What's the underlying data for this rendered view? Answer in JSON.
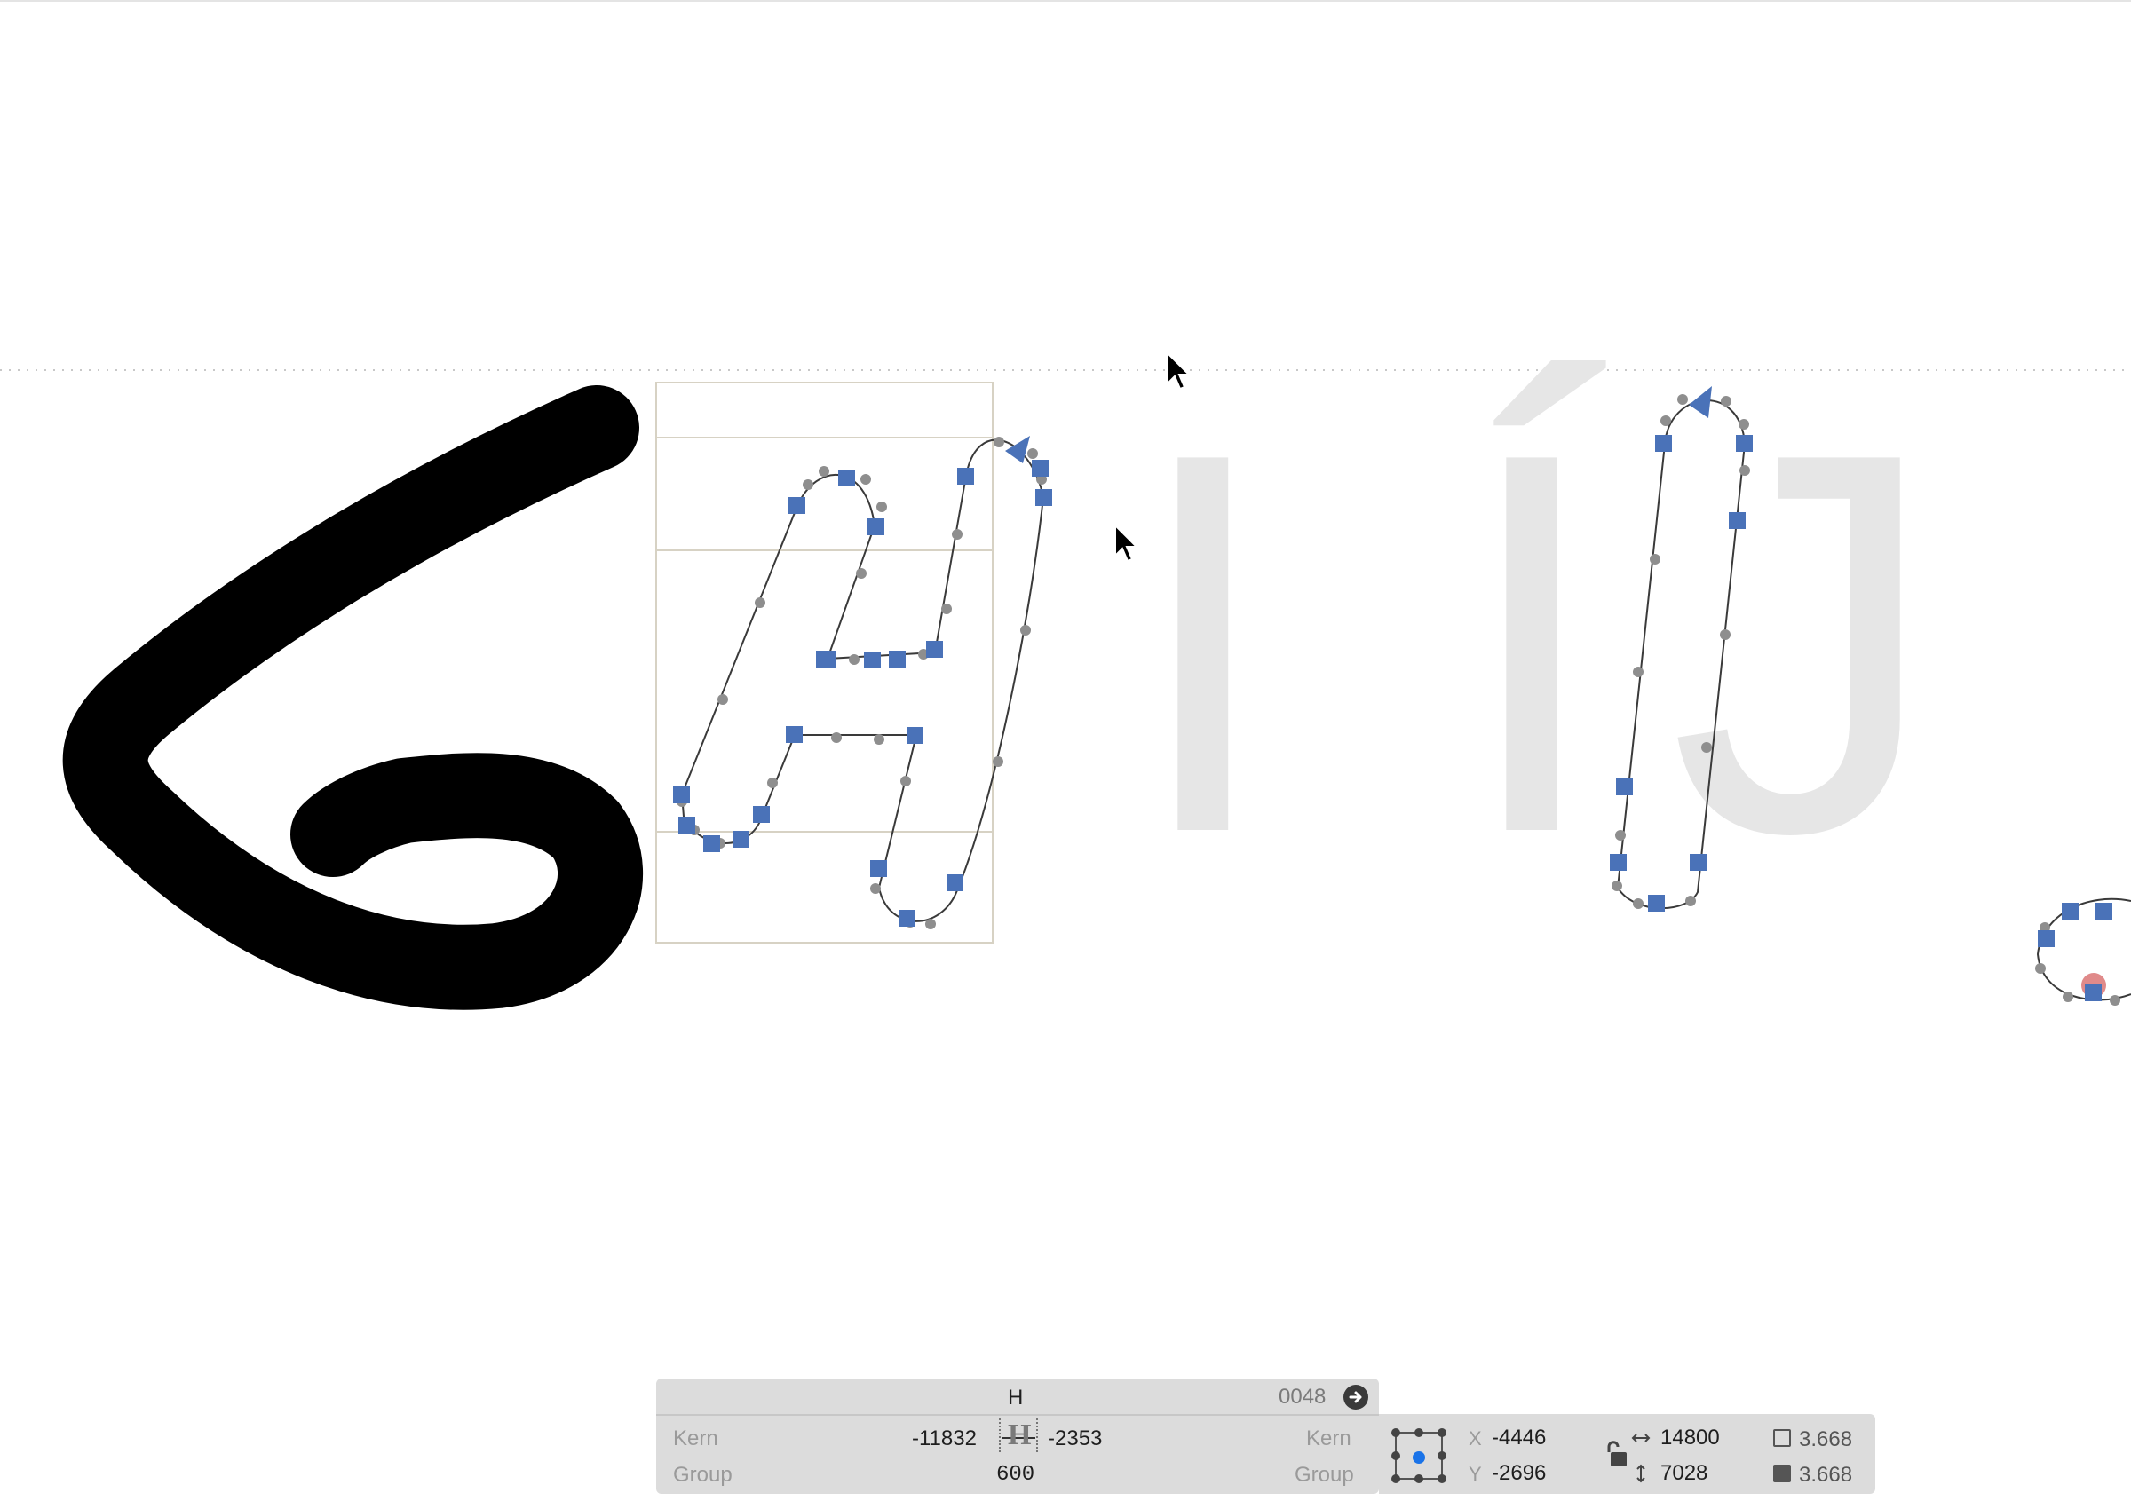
{
  "glyph_info": {
    "name": "H",
    "unicode": "0048",
    "left_kern_label": "Kern",
    "left_group_label": "Group",
    "left_sidebearing": "-11832",
    "right_sidebearing": "-2353",
    "width": "600",
    "right_kern_label": "Kern",
    "right_group_label": "Group",
    "glyph_preview": "H"
  },
  "transform": {
    "x_label": "X",
    "x_value": "-4446",
    "y_label": "Y",
    "y_value": "-2696",
    "width_value": "14800",
    "height_value": "7028",
    "stroke_width_1": "3.668",
    "stroke_width_2": "3.668"
  },
  "background_glyphs": [
    "I",
    "Í",
    "J"
  ],
  "colors": {
    "node_blue": "#4a72b8",
    "handle_gray": "#8e8e8e",
    "ghost_glyph": "#e6e6e6",
    "stroke_black": "#000000",
    "panel_bg": "#dcdcdc",
    "selection_dot": "#1a73e8"
  }
}
